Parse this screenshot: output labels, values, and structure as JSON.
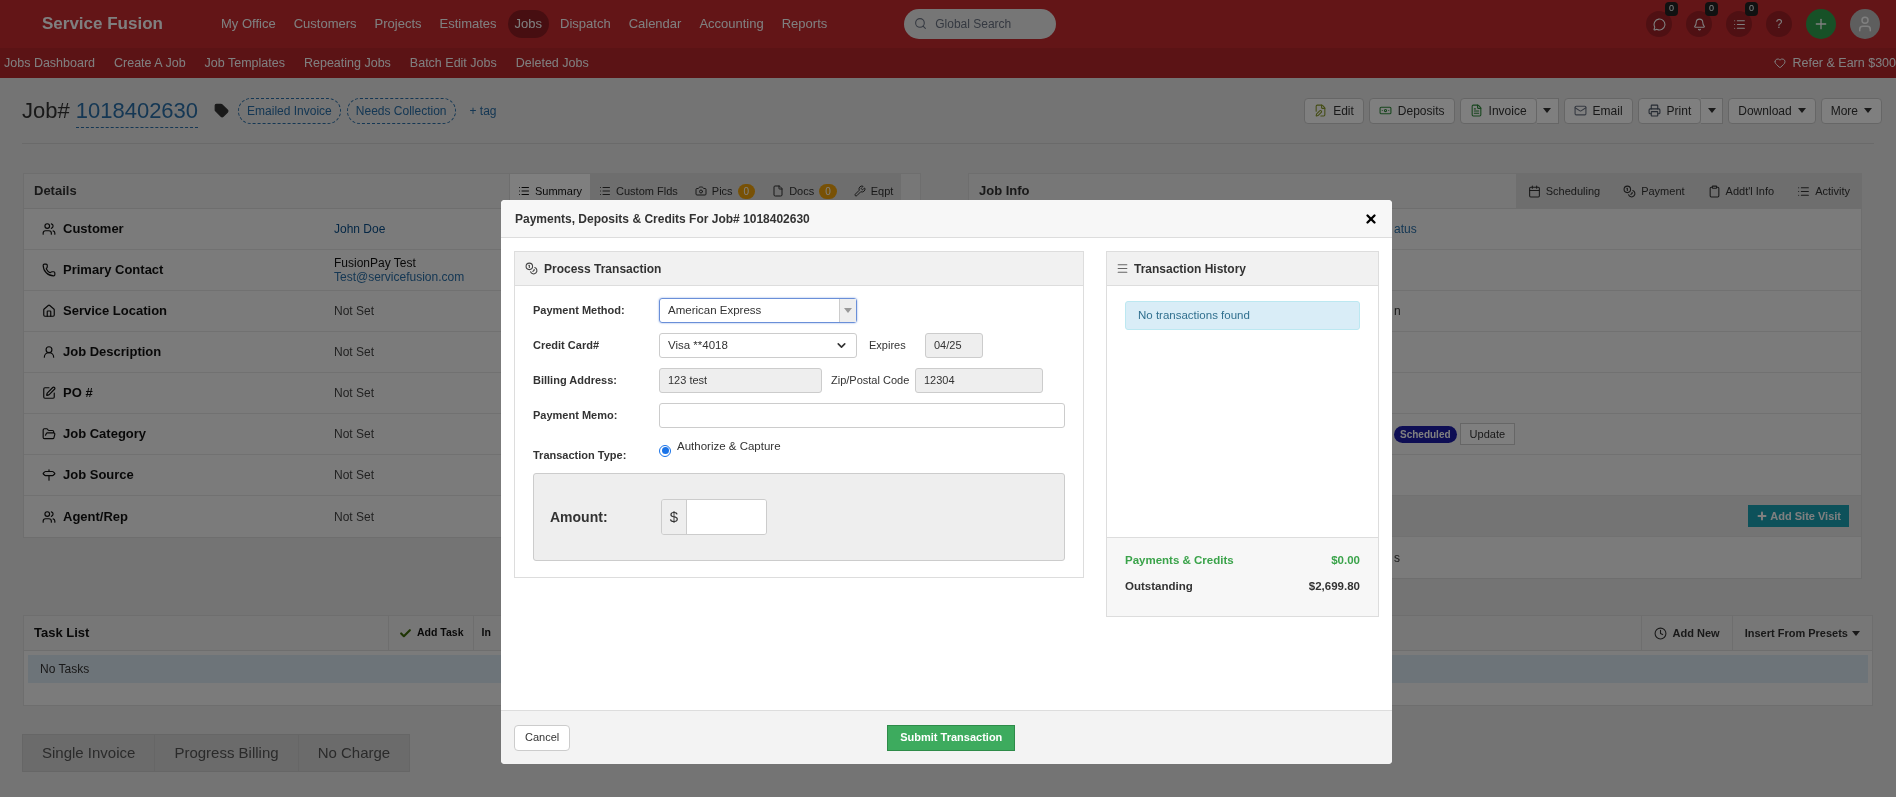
{
  "nav": {
    "logo": "Service Fusion",
    "items": [
      {
        "label": "My Office",
        "selected": false
      },
      {
        "label": "Customers",
        "selected": false
      },
      {
        "label": "Projects",
        "selected": false
      },
      {
        "label": "Estimates",
        "selected": false
      },
      {
        "label": "Jobs",
        "selected": true
      },
      {
        "label": "Dispatch",
        "selected": false
      },
      {
        "label": "Calendar",
        "selected": false
      },
      {
        "label": "Accounting",
        "selected": false
      },
      {
        "label": "Reports",
        "selected": false
      }
    ],
    "search": {
      "placeholder": "Global Search"
    },
    "badges": [
      {
        "kind": "chat",
        "count": "0"
      },
      {
        "kind": "bell",
        "count": "0"
      },
      {
        "kind": "list",
        "count": "0"
      }
    ],
    "help": "?"
  },
  "subnav": {
    "items": [
      "Jobs Dashboard",
      "Create A Job",
      "Job Templates",
      "Repeating Jobs",
      "Batch Edit Jobs",
      "Deleted Jobs"
    ],
    "refer": "Refer & Earn $300"
  },
  "job": {
    "label": "Job#",
    "number": "1018402630",
    "tags": [
      "Emailed Invoice",
      "Needs Collection"
    ],
    "add_tag": "+ tag",
    "actions": [
      {
        "label": "Edit",
        "kind": "edit"
      },
      {
        "label": "Deposits",
        "kind": "money"
      },
      {
        "label": "Invoice",
        "kind": "invoice",
        "split": true
      },
      {
        "label": "Email",
        "kind": "mail"
      },
      {
        "label": "Print",
        "kind": "print",
        "split": true
      },
      {
        "label": "Download",
        "kind": "dropdown"
      },
      {
        "label": "More",
        "kind": "dropdown"
      }
    ]
  },
  "details": {
    "title": "Details",
    "tabs": [
      {
        "label": "Summary",
        "kind": "list",
        "selected": true
      },
      {
        "label": "Custom Flds",
        "kind": "list",
        "selected": false
      },
      {
        "label": "Pics",
        "kind": "camera",
        "count": "0",
        "selected": false
      },
      {
        "label": "Docs",
        "kind": "doc",
        "count": "0",
        "selected": false
      },
      {
        "label": "Eqpt",
        "kind": "tool",
        "selected": false
      }
    ],
    "rows": [
      {
        "kind": "users",
        "label": "Customer",
        "value": "John Doe",
        "link": true
      },
      {
        "kind": "phone",
        "label": "Primary Contact",
        "value": "FusionPay Test",
        "value2": "Test@servicefusion.com",
        "link": false
      },
      {
        "kind": "home",
        "label": "Service Location",
        "value": "Not Set",
        "link": false
      },
      {
        "kind": "user",
        "label": "Job Description",
        "value": "Not Set",
        "link": false
      },
      {
        "kind": "edit",
        "label": "PO #",
        "value": "Not Set",
        "link": false
      },
      {
        "kind": "folder",
        "label": "Job Category",
        "value": "Not Set",
        "link": false
      },
      {
        "kind": "sign",
        "label": "Job Source",
        "value": "Not Set",
        "link": false
      },
      {
        "kind": "users",
        "label": "Agent/Rep",
        "value": "Not Set",
        "link": false
      }
    ]
  },
  "job_info": {
    "title": "Job Info",
    "tabs": [
      {
        "label": "Scheduling",
        "kind": "calendar",
        "selected": false
      },
      {
        "label": "Payment",
        "kind": "coins",
        "selected": false
      },
      {
        "label": "Addt'l Info",
        "kind": "clipboard",
        "selected": false
      },
      {
        "label": "Activity",
        "kind": "list",
        "selected": false
      }
    ],
    "rows": [
      {
        "kind": "link",
        "text": "atus"
      },
      {
        "kind": "empty"
      },
      {
        "kind": "text",
        "text": "n"
      },
      {
        "kind": "empty"
      },
      {
        "kind": "empty"
      },
      {
        "kind": "status",
        "badge": "Scheduled",
        "button": "Update"
      },
      {
        "kind": "empty"
      },
      {
        "kind": "action",
        "button": "Add Site Visit"
      },
      {
        "kind": "text",
        "text": "s"
      }
    ]
  },
  "task_list": {
    "title": "Task List",
    "add_task": "Add Task",
    "cut_button": "In",
    "add_new": "Add New",
    "presets": "Insert From Presets",
    "empty": "No Tasks"
  },
  "billing_tabs": [
    {
      "label": "Single Invoice",
      "selected": false
    },
    {
      "label": "Progress Billing",
      "selected": false
    },
    {
      "label": "No Charge",
      "selected": false
    }
  ],
  "modal": {
    "title": "Payments, Deposits & Credits For Job# 1018402630",
    "process": {
      "title": "Process Transaction",
      "payment_method": {
        "label": "Payment Method:",
        "value": "American Express"
      },
      "credit_card": {
        "label": "Credit Card#",
        "value": "Visa **4018",
        "expires_label": "Expires",
        "expires": "04/25"
      },
      "billing": {
        "label": "Billing Address:",
        "value": "123 test",
        "zip_label": "Zip/Postal Code",
        "zip": "12304"
      },
      "memo": {
        "label": "Payment Memo:"
      },
      "transaction_type": {
        "label": "Transaction Type:",
        "option": "Authorize & Capture",
        "checked": true
      },
      "amount": {
        "label": "Amount:",
        "currency": "$"
      }
    },
    "history": {
      "title": "Transaction History",
      "empty": "No transactions found",
      "payments_label": "Payments & Credits",
      "payments": "$0.00",
      "outstanding_label": "Outstanding",
      "outstanding": "$2,699.80"
    },
    "cancel": "Cancel",
    "submit": "Submit Transaction"
  }
}
